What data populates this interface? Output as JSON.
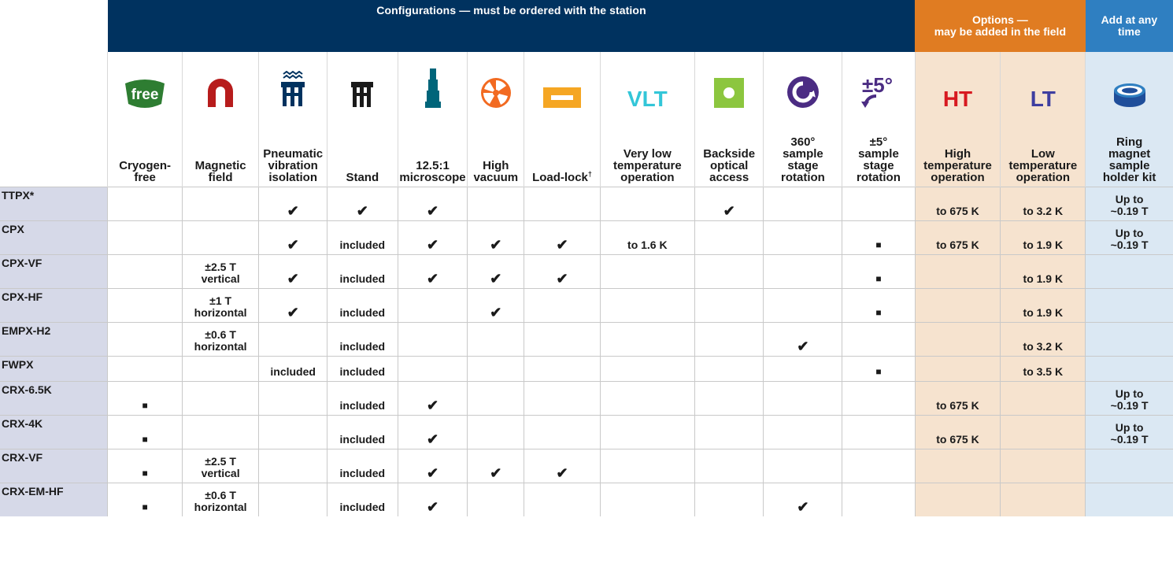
{
  "groups": {
    "configurations": "Configurations — must be ordered with the station",
    "options_line1": "Options —",
    "options_line2": "may be added in the field",
    "any_line1": "Add at any",
    "any_line2": "time"
  },
  "icons": {
    "free_text": "free",
    "vlt_text": "VLT",
    "rot5_text": "±5°",
    "ht_text": "HT",
    "lt_text": "LT"
  },
  "columns": [
    [
      "Cryogen-",
      "free"
    ],
    [
      "Magnetic",
      "field"
    ],
    [
      "Pneumatic",
      "vibration",
      "isolation"
    ],
    [
      "Stand"
    ],
    [
      "12.5:1",
      "microscope"
    ],
    [
      "High",
      "vacuum"
    ],
    [
      "Load-lock"
    ],
    [
      "Very low",
      "temperature",
      "operation"
    ],
    [
      "Backside",
      "optical",
      "access"
    ],
    [
      "360°",
      "sample",
      "stage",
      "rotation"
    ],
    [
      "±5°",
      "sample",
      "stage",
      "rotation"
    ],
    [
      "High",
      "temperature",
      "operation"
    ],
    [
      "Low",
      "temperature",
      "operation"
    ],
    [
      "Ring",
      "magnet",
      "sample",
      "holder kit"
    ]
  ],
  "loadlock_mark": "†",
  "symbols": {
    "check": "✔",
    "square": "■"
  },
  "rows": [
    {
      "model": "TTPX*",
      "cells": [
        "",
        "",
        "✔",
        "✔",
        "✔",
        "",
        "",
        "",
        "✔",
        "",
        "",
        "to 675 K",
        "to 3.2 K",
        [
          "Up to",
          "~0.19 T"
        ]
      ]
    },
    {
      "model": "CPX",
      "cells": [
        "",
        "",
        "✔",
        "included",
        "✔",
        "✔",
        "✔",
        "to 1.6 K",
        "",
        "",
        "■",
        "to 675 K",
        "to 1.9 K",
        [
          "Up to",
          "~0.19 T"
        ]
      ]
    },
    {
      "model": "CPX-VF",
      "cells": [
        "",
        [
          "±2.5 T",
          "vertical"
        ],
        "✔",
        "included",
        "✔",
        "✔",
        "✔",
        "",
        "",
        "",
        "■",
        "",
        "to 1.9 K",
        ""
      ]
    },
    {
      "model": "CPX-HF",
      "cells": [
        "",
        [
          "±1 T",
          "horizontal"
        ],
        "✔",
        "included",
        "",
        "✔",
        "",
        "",
        "",
        "",
        "■",
        "",
        "to 1.9 K",
        ""
      ]
    },
    {
      "model": "EMPX-H2",
      "cells": [
        "",
        [
          "±0.6 T",
          "horizontal"
        ],
        "",
        "included",
        "",
        "",
        "",
        "",
        "",
        "✔",
        "",
        "",
        "to 3.2 K",
        ""
      ]
    },
    {
      "model": "FWPX",
      "cells": [
        "",
        "",
        "included",
        "included",
        "",
        "",
        "",
        "",
        "",
        "",
        "■",
        "",
        "to 3.5 K",
        ""
      ]
    },
    {
      "model": "CRX-6.5K",
      "cells": [
        "■",
        "",
        "",
        "included",
        "✔",
        "",
        "",
        "",
        "",
        "",
        "",
        "to 675 K",
        "",
        [
          "Up to",
          "~0.19 T"
        ]
      ]
    },
    {
      "model": "CRX-4K",
      "cells": [
        "■",
        "",
        "",
        "included",
        "✔",
        "",
        "",
        "",
        "",
        "",
        "",
        "to 675 K",
        "",
        [
          "Up to",
          "~0.19 T"
        ]
      ]
    },
    {
      "model": "CRX-VF",
      "cells": [
        "■",
        [
          "±2.5 T",
          "vertical"
        ],
        "",
        "included",
        "✔",
        "✔",
        "✔",
        "",
        "",
        "",
        "",
        "",
        "",
        ""
      ]
    },
    {
      "model": "CRX-EM-HF",
      "cells": [
        "■",
        [
          "±0.6 T",
          "horizontal"
        ],
        "",
        "included",
        "✔",
        "",
        "",
        "",
        "",
        "✔",
        "",
        "",
        "",
        ""
      ]
    }
  ],
  "colors": {
    "navy": "#00325f",
    "orange": "#e07c22",
    "blue": "#2f7fc1",
    "options_bg": "#f6e3cf",
    "any_bg": "#dbe8f3",
    "model_bg": "#d6d9e8",
    "icon_green": "#2e7d32",
    "icon_red": "#b71c1c",
    "icon_teal": "#00657a",
    "icon_orange": "#f26a21",
    "icon_yellow": "#f5a623",
    "icon_cyan": "#33c6d8",
    "icon_lime": "#8cc63f",
    "icon_purple": "#4b2c83",
    "icon_ht": "#d71920",
    "icon_lt": "#3e3ea0"
  }
}
